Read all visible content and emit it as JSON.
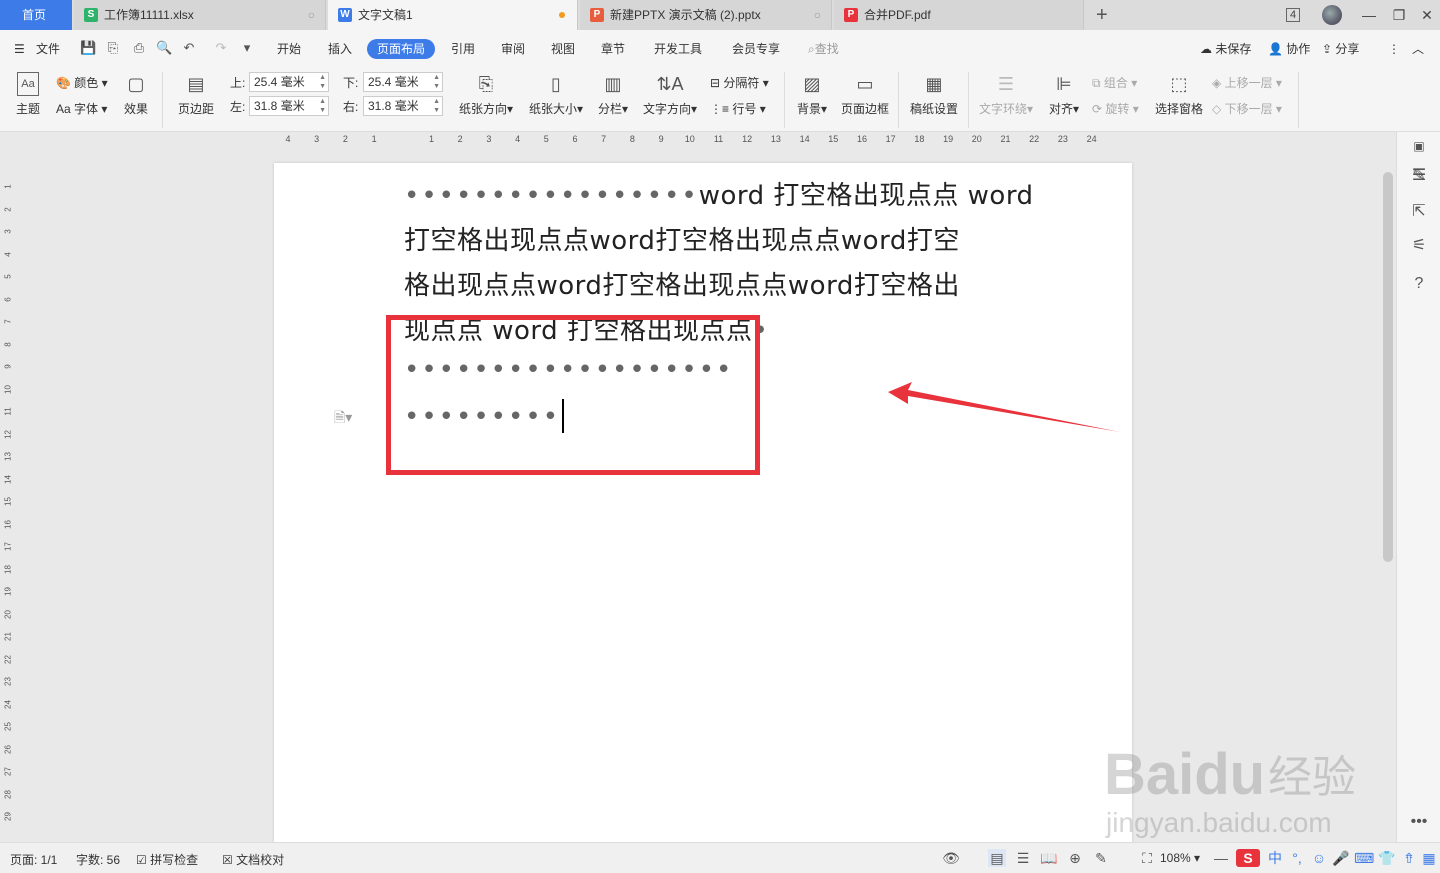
{
  "tabs": {
    "home": "首页",
    "items": [
      {
        "label": "工作簿11111.xlsx",
        "icon_text": "S",
        "color": "#2fb36b",
        "close": "○"
      },
      {
        "label": "文字文稿1",
        "icon_text": "W",
        "color": "#3d7ce8",
        "close": ""
      },
      {
        "label": "新建PPTX 演示文稿 (2).pptx",
        "icon_text": "P",
        "color": "#e85d3d",
        "close": "○"
      },
      {
        "label": "合并PDF.pdf",
        "icon_text": "P",
        "color": "#e8323c",
        "close": ""
      }
    ],
    "add": "+",
    "badge": "4"
  },
  "menu": {
    "file": "文件",
    "items": [
      "开始",
      "插入",
      "页面布局",
      "引用",
      "审阅",
      "视图",
      "章节",
      "开发工具",
      "会员专享"
    ],
    "active": "页面布局",
    "search": "查找",
    "unsaved": "未保存",
    "collab": "协作",
    "share": "分享"
  },
  "ribbon": {
    "theme": "主题",
    "colors": "颜色",
    "fonts": "字体",
    "effects": "效果",
    "margins": "页边距",
    "top_label": "上:",
    "top_value": "25.4 毫米",
    "bottom_label": "下:",
    "bottom_value": "25.4 毫米",
    "left_label": "左:",
    "left_value": "31.8 毫米",
    "right_label": "右:",
    "right_value": "31.8 毫米",
    "orientation": "纸张方向",
    "size": "纸张大小",
    "columns": "分栏",
    "text_direction": "文字方向",
    "breaks": "分隔符",
    "line_numbers": "行号",
    "background": "背景",
    "page_border": "页面边框",
    "manuscript": "稿纸设置",
    "text_wrap": "文字环绕",
    "align": "对齐",
    "group": "组合",
    "rotate": "旋转",
    "selection_pane": "选择窗格",
    "bring_forward": "上移一层",
    "send_backward": "下移一层"
  },
  "ruler": {
    "h_ticks": [
      "4",
      "3",
      "2",
      "1",
      "",
      "1",
      "2",
      "3",
      "4",
      "5",
      "6",
      "7",
      "8",
      "9",
      "10",
      "11",
      "12",
      "13",
      "14",
      "15",
      "16",
      "17",
      "18",
      "19",
      "20",
      "21",
      "22",
      "23",
      "24"
    ],
    "v_ticks": [
      "1",
      "2",
      "3",
      "4",
      "5",
      "6",
      "7",
      "8",
      "9",
      "10",
      "11",
      "12",
      "13",
      "14",
      "15",
      "16",
      "17",
      "18",
      "19",
      "20",
      "21",
      "22",
      "23",
      "24",
      "25",
      "26",
      "27",
      "28",
      "29"
    ]
  },
  "document": {
    "line1_dots": "•••••••••••••••••",
    "line1_text": "word 打空格出现点点 word",
    "line2": "打空格出现点点word打空格出现点点word打空",
    "line3": "格出现点点word打空格出现点点word打空格出",
    "line4": "现点点 word 打空格出现点点",
    "line4_dot": "•",
    "line5": "•••••••••••••••••••",
    "line6": "•••••••••"
  },
  "status": {
    "page": "页面: 1/1",
    "words": "字数: 56",
    "spell": "拼写检查",
    "proof": "文档校对",
    "zoom": "108%"
  },
  "watermark": {
    "brand": "Baidu",
    "suffix": "经验",
    "url": "jingyan.baidu.com"
  },
  "colors": {
    "accent": "#3d7ce8",
    "highlight_box": "#e8323c"
  }
}
